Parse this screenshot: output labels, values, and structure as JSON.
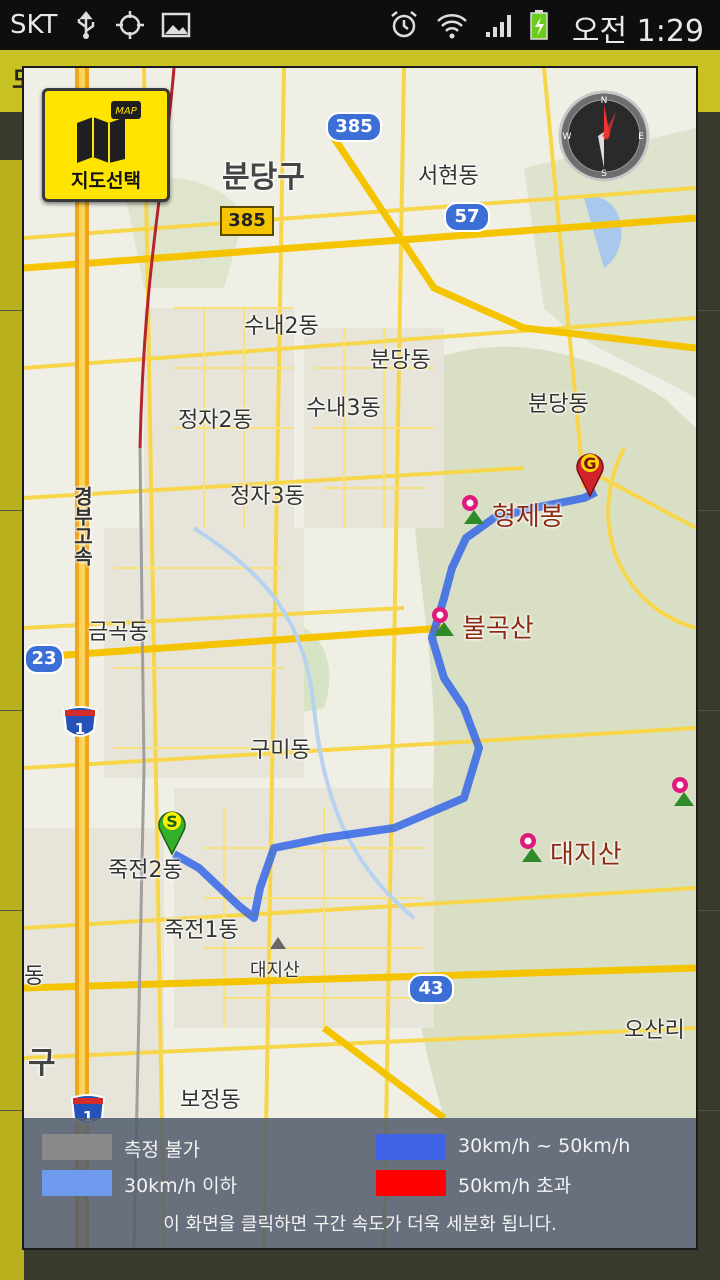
{
  "status_bar": {
    "carrier": "SKT",
    "time": "오전 1:29",
    "icons": [
      "usb-icon",
      "gps-icon",
      "gallery-icon",
      "alarm-icon",
      "wifi-icon",
      "signal-icon",
      "battery-charging-icon"
    ]
  },
  "map_select": {
    "label": "지도선택",
    "badge": "MAP"
  },
  "map": {
    "district": "분당구",
    "dongs": [
      "서현동",
      "수내2동",
      "분당동",
      "수내3동",
      "분당동",
      "정자2동",
      "정자3동",
      "금곡동",
      "구미동",
      "죽전2동",
      "죽전1동",
      "대지산",
      "오산리",
      "보정동",
      "구",
      "동"
    ],
    "peaks": [
      "형제봉",
      "불곡산",
      "대지산"
    ],
    "expressway": "경부고속",
    "road_shields": [
      "385",
      "385",
      "57",
      "23",
      "1",
      "43",
      "1"
    ],
    "start_marker": "S",
    "goal_marker": "G"
  },
  "legend": {
    "items": [
      {
        "label": "측정 불가",
        "color": "#8a8a8a"
      },
      {
        "label": "30km/h ~ 50km/h",
        "color": "#3f62e6"
      },
      {
        "label": "30km/h 이하",
        "color": "#6f9bee"
      },
      {
        "label": "50km/h 초과",
        "color": "#ff0000"
      }
    ],
    "hint": "이 화면을 클릭하면 구간 속도가 더욱 세분화 됩니다."
  },
  "background_app": {
    "title": "도로교통"
  },
  "colors": {
    "accent": "#ffe400",
    "route": "#4a7bf0",
    "road_major": "#f7d64a"
  }
}
